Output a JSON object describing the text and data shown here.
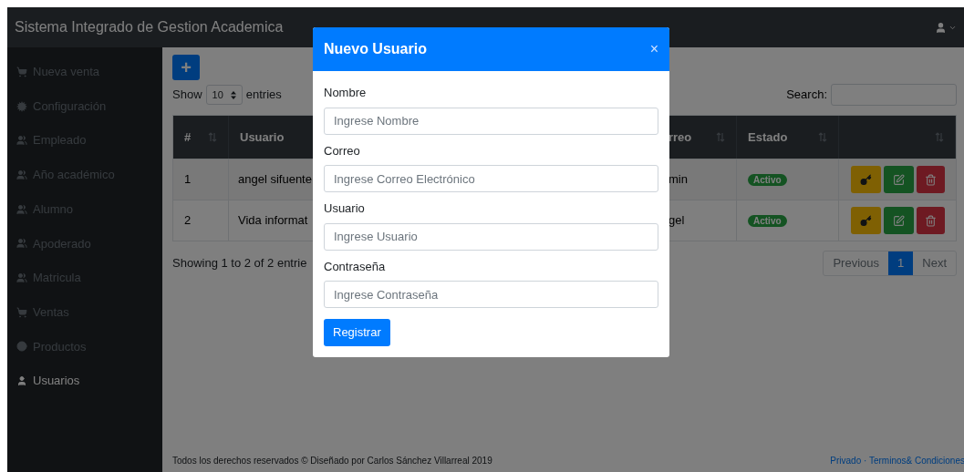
{
  "navbar": {
    "title": "Sistema Integrado de Gestion Academica"
  },
  "sidebar": {
    "items": [
      {
        "label": "Nueva venta",
        "selected": false
      },
      {
        "label": "Configuración",
        "selected": false
      },
      {
        "label": "Empleado",
        "selected": false
      },
      {
        "label": "Año académico",
        "selected": false
      },
      {
        "label": "Alumno",
        "selected": false
      },
      {
        "label": "Apoderado",
        "selected": false
      },
      {
        "label": "Matricula",
        "selected": false
      },
      {
        "label": "Ventas",
        "selected": false
      },
      {
        "label": "Productos",
        "selected": false
      },
      {
        "label": "Usuarios",
        "selected": true
      }
    ]
  },
  "add_button": "+",
  "length": {
    "show": "Show",
    "value": "10",
    "entries": "entries"
  },
  "search": {
    "label": "Search:"
  },
  "table": {
    "columns": [
      {
        "label": "#",
        "sortable": true
      },
      {
        "label": "Usuario"
      },
      {
        "label": "rreo",
        "sortable": true
      },
      {
        "label": "Estado",
        "sortable": true
      },
      {
        "sortable": true
      }
    ],
    "rows": [
      {
        "number": "1",
        "usuario": "angel sifuente",
        "correo": "min",
        "estado": "Activo"
      },
      {
        "number": "2",
        "usuario": "Vida informat",
        "correo": "gel",
        "estado": "Activo"
      }
    ]
  },
  "info": "Showing 1 to 2 of 2 entrie",
  "pagination": [
    {
      "label": "Previous",
      "selected": false
    },
    {
      "label": "1",
      "selected": true
    },
    {
      "label": "Next",
      "selected": false
    }
  ],
  "footer": {
    "text": "Todos los derechos reservados © Diseñado por Carlos Sánchez Villarreal 2019",
    "links": "Privado · Terminos& Condiciones"
  },
  "modal": {
    "title": "Nuevo Usuario",
    "close": "×",
    "fields": [
      {
        "label": "Nombre",
        "placeholder": "Ingrese Nombre"
      },
      {
        "label": "Correo",
        "placeholder": "Ingrese Correo Electrónico"
      },
      {
        "label": "Usuario",
        "placeholder": "Ingrese Usuario"
      },
      {
        "label": "Contraseña",
        "placeholder": "Ingrese Contraseña"
      }
    ],
    "submit": "Registrar"
  }
}
